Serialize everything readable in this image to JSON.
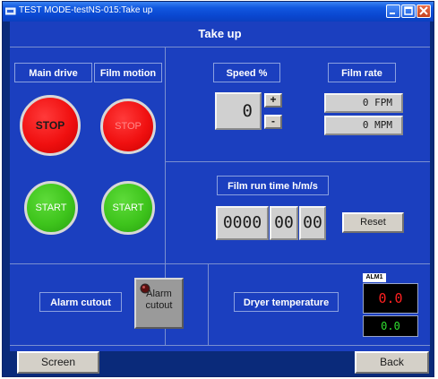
{
  "window": {
    "title": "TEST MODE-testNS-015:Take up"
  },
  "panel": {
    "title": "Take up"
  },
  "main_drive": {
    "label": "Main drive",
    "stop": "STOP",
    "start": "START"
  },
  "film_motion": {
    "label": "Film motion",
    "stop": "STOP",
    "start": "START"
  },
  "speed": {
    "label": "Speed %",
    "value": "0",
    "plus": "+",
    "minus": "-"
  },
  "film_rate": {
    "label": "Film rate",
    "fpm": "0 FPM",
    "mpm": "0 MPM"
  },
  "film_run_time": {
    "label": "Film run time h/m/s",
    "hours": "0000",
    "minutes": "00",
    "seconds": "00",
    "reset": "Reset"
  },
  "alarm_cutout": {
    "label": "Alarm cutout",
    "button": "Alarm cutout"
  },
  "dryer": {
    "label": "Dryer temperature",
    "alarm_tag": "ALM1",
    "setpoint": "0.0",
    "actual": "0.0"
  },
  "footer": {
    "screen": "Screen",
    "back": "Back"
  },
  "colors": {
    "background": "#1b3fbf",
    "stop": "#f01010",
    "start": "#3ec41c",
    "alarm_red": "#ff2020",
    "alarm_green": "#30e030"
  }
}
